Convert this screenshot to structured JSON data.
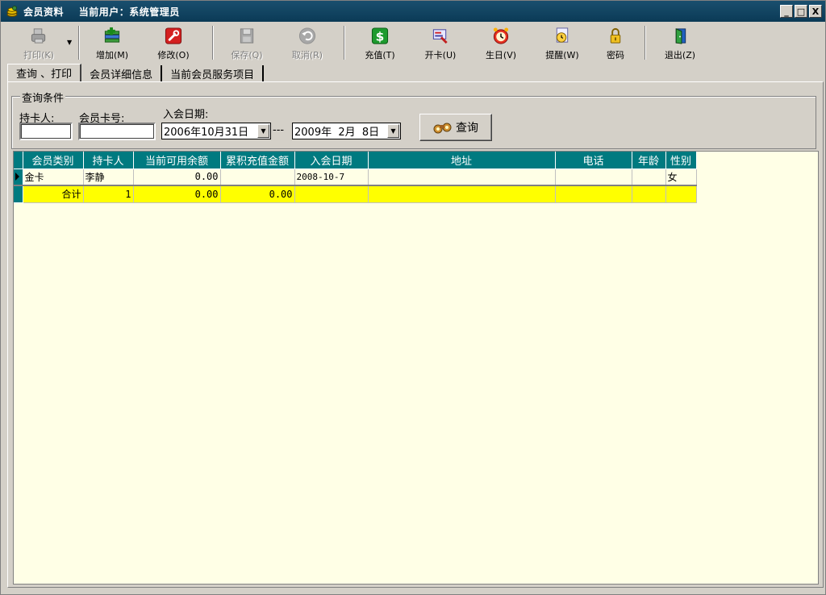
{
  "window": {
    "title": "会员资料    当前用户：系统管理员",
    "minimize": "_",
    "maximize": "□",
    "close": "X"
  },
  "toolbar": {
    "print": "打印(K)",
    "add": "增加(M)",
    "edit": "修改(O)",
    "save": "保存(Q)",
    "cancel": "取消(R)",
    "recharge": "充值(T)",
    "open_card": "开卡(U)",
    "birthday": "生日(V)",
    "remind": "提醒(W)",
    "password": "密码",
    "exit": "退出(Z)"
  },
  "tabs": [
    {
      "label": "查询 、打印"
    },
    {
      "label": "会员详细信息"
    },
    {
      "label": "当前会员服务项目"
    }
  ],
  "query": {
    "group_title": "查询条件",
    "holder_label": "持卡人:",
    "holder_value": "",
    "card_label": "会员卡号:",
    "card_value": "",
    "date_label": "入会日期:",
    "date_from": "2006年10月31日",
    "date_sep": "---",
    "date_to": "2009年  2月  8日",
    "search_button": "查询"
  },
  "grid": {
    "columns": [
      "会员类别",
      "持卡人",
      "当前可用余额",
      "累积充值金额",
      "入会日期",
      "地址",
      "电话",
      "年龄",
      "性别"
    ],
    "rows": [
      {
        "type": "金卡",
        "holder": "李静",
        "balance": "0.00",
        "recharge_total": "",
        "join_date": "2008-10-7",
        "address": "",
        "phone": "",
        "age": "",
        "gender": "女"
      }
    ],
    "total": {
      "label": "合计",
      "count": "1",
      "balance": "0.00",
      "recharge_total": "0.00"
    }
  },
  "colors": {
    "title_bar": "#0b3a56",
    "grid_header": "#007a80",
    "grid_bg": "#ffffe6",
    "total_row": "#ffff00"
  }
}
